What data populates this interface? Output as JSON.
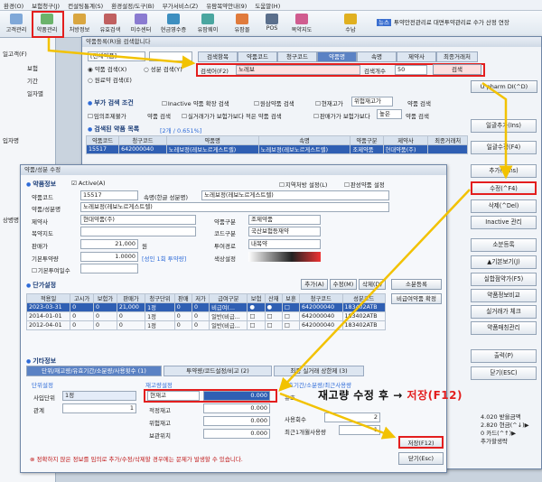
{
  "menu": [
    "환경(O)",
    "보험청구(J)",
    "컨설팅통계(S)",
    "환경설정/도구(B)",
    "부가서비스(Z)",
    "유팜복약안내(9)",
    "도움말(H)"
  ],
  "toolbar": {
    "buttons": [
      "고객관리",
      "약품관리",
      "처방정보",
      "유효검색",
      "미수센터",
      "현금영수증",
      "유팜웨이",
      "유팜몰",
      "POS",
      "복약지도",
      "수납"
    ],
    "news_tag": "뉴스",
    "news_text": "투약안전관리료 대면투약관리료 수가 산정 연장"
  },
  "left_strip": {
    "items": [
      "일고객(F)",
      "보험",
      "기간",
      "일자별",
      "입자명",
      "상병명"
    ]
  },
  "search_window": {
    "title": "약품등록(R)을 검색합니다",
    "combo_kind": "[전체약품]",
    "radio_name": "약품 검색(X)",
    "radio_ingredient": "성분 검색(Y)",
    "radio_keep": "원료약 검색(E)",
    "tabs": [
      "검색항목",
      "약품코드",
      "청구코드",
      "약품명",
      "속명",
      "제약사",
      "최종거래처"
    ],
    "active_tab": "약품명",
    "search_label": "검색어(F2)",
    "search_value": "노레보",
    "count_label": "검색개수",
    "count_value": "50",
    "search_button": "검색",
    "upharm_button": "U pharm DI(^D)",
    "extra_section": "부가 검색 조건",
    "extra_options": [
      "Inactive 약품 확장 검색",
      "원삼약품 검색",
      "현재고가",
      "위험재고가",
      "약품 검색"
    ],
    "extra_row2": [
      "임의조제불가",
      "약품 검색",
      "실거래가가 보험가보다 적은 약품 검색",
      "판매가가 보험가보다",
      "높은",
      "약품 검색"
    ],
    "result_section": "검색된 약품 목록",
    "result_count": "[2개 / 0.651%]",
    "result_headers": [
      "약품코드",
      "청구코드",
      "약품명",
      "속명",
      "약품구분",
      "제약사",
      "최종거래처"
    ],
    "result_row": [
      "15517",
      "642000040",
      "노레보정(레보노르게스트렐)",
      "노레보정(레보노르게스트렐)",
      "조제약품",
      "현대약품(주)",
      ""
    ]
  },
  "right_buttons": [
    "일괄추가(Ins)",
    "일괄수정(F4)",
    "추가(^Ins)",
    "수정(^F4)",
    "삭제(^Del)",
    "Inactive 관리",
    "소분등록",
    "▲기본보기(J)",
    "실합점약가(F5)",
    "약품정보비교",
    "실거래가 체크",
    "약품매칭관리",
    "출력(P)",
    "닫기(ESC)"
  ],
  "highlight_button": "수정(^F4)",
  "edit_window": {
    "title": "약품/성분 수정",
    "drug_section": "약품정보",
    "active_label": "Active(A)",
    "region_label": "지역처방 설정(L)",
    "gift_label": "판성약품 설정",
    "code_label": "약품코드",
    "code_value": "15517",
    "generic_label": "속명(한글 성분명)",
    "generic_value": "노레보정(레보노르게스트렐)",
    "name_label": "약품/성분명",
    "name_value": "노레보정(레보노르게스트렐)",
    "maker_label": "제약사",
    "maker_value": "현대약품(주)",
    "kind_label": "약품구분",
    "kind_value": "조제약품",
    "guide_label": "복약지도",
    "code_kind_label": "코드구분",
    "code_kind_value": "국산보험등재약",
    "price_label": "판매가",
    "price_value": "21,000",
    "price_unit": "원",
    "route_label": "투여경로",
    "route_value": "내복약",
    "dose_label": "기본투약량",
    "dose_value": "1.0000",
    "dose_note": "[성인 1회 투약량]",
    "color_label": "색상설정",
    "base_label": "기본투여일수",
    "unit_section": "단가설정",
    "unit_buttons": [
      "추가(A)",
      "수정(M)",
      "삭제(D)"
    ],
    "sobun_button": "소분등록",
    "compare_button": "비급여약품 확정",
    "unit_headers": [
      "적용일",
      "고시가",
      "보험가",
      "판매가",
      "청구단위",
      "판매",
      "저가",
      "급여구분",
      "보험",
      "산재",
      "보훈",
      "청구코드",
      "성분코드"
    ],
    "unit_rows": [
      [
        "2023-03-31",
        "0",
        "0",
        "21,000",
        "1정",
        "0",
        "0",
        "비급여(...",
        "●",
        "●",
        "□",
        "642000040",
        "183402ATB"
      ],
      [
        "2014-01-01",
        "0",
        "0",
        "0",
        "1정",
        "0",
        "0",
        "일반(비급...",
        "□",
        "□",
        "□",
        "642000040",
        "183402ATB"
      ],
      [
        "2012-04-01",
        "0",
        "0",
        "0",
        "1정",
        "0",
        "0",
        "일반(비급...",
        "□",
        "□",
        "□",
        "642000040",
        "183402ATB"
      ]
    ],
    "etc_section": "기타정보",
    "etc_tabs": [
      "단위/재고량/유효기간/소분량/사용횟수 (1)",
      "투약량/코드설정/비고 (2)",
      "최종 실거래 상한제 (3)"
    ],
    "unit_setting_title": "단위설정",
    "use_unit_label": "사입단위",
    "use_unit_value": "1정",
    "relation_label": "관계",
    "relation_value": "1",
    "stock_title": "재고량설정",
    "stock_label": "현재고",
    "stock_value": "0.000",
    "proper_label": "적정재고",
    "proper_value": "0.000",
    "danger_label": "위험재고",
    "danger_value": "0.000",
    "ratio_label": "보관위치",
    "ratio_value": "0.000",
    "expiry_title": "유효기간/소분량/최근사용량",
    "valid_label": "유효",
    "uses_label": "사용회수",
    "uses_value": "2",
    "last_label": "최근1개월사용량",
    "last_value": "1",
    "save_button": "저장(F12)",
    "close_button": "닫기(Esc)",
    "warning": "정확하지 않은 정보를 임의로 추가/수정/삭제할 경우에는 문제가 발생할 수 있습니다."
  },
  "annotation": {
    "text": "재고량 수정 후",
    "arrow": "→",
    "action": "저장(F12)"
  },
  "bottom_right": {
    "values": [
      "4.020",
      "2.820",
      "0"
    ],
    "labels": [
      "받을금액",
      "현금(^↓)▶",
      "카드(^↑)▶",
      "추가할생략"
    ]
  },
  "colors": {
    "accent": "#2e6bd8",
    "highlight": "#e31e1e",
    "arrow": "#f2c200",
    "selected_row": "#2f5fb3"
  }
}
